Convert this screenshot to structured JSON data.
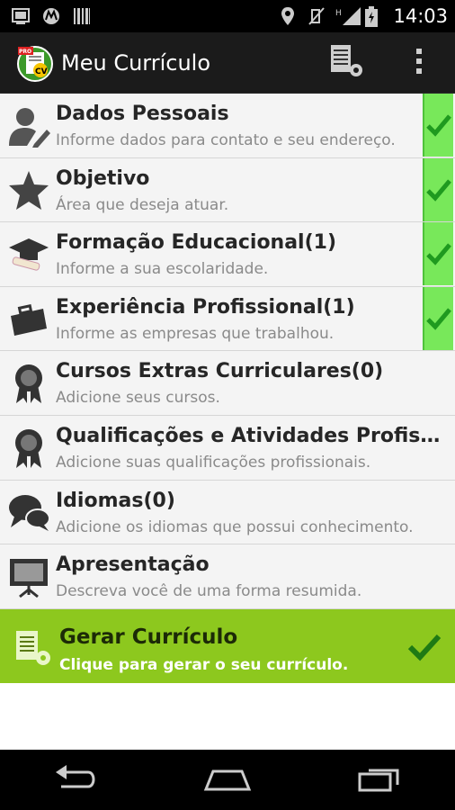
{
  "status_bar": {
    "time": "14:03",
    "icons": [
      "screenshot-icon",
      "motorola-icon",
      "barcode-icon",
      "location-icon",
      "mute-icon",
      "signal-h-icon",
      "battery-icon"
    ]
  },
  "action_bar": {
    "title": "Meu Currículo",
    "app_icon_badge": "PRO",
    "app_icon_letters": "CV",
    "actions": [
      "settings-document-icon",
      "overflow-menu-icon"
    ]
  },
  "sections": [
    {
      "title": "Dados Pessoais",
      "subtitle": "Informe dados para contato e seu endereço.",
      "icon": "user-edit-icon",
      "completed": true
    },
    {
      "title": "Objetivo",
      "subtitle": "Área que deseja atuar.",
      "icon": "star-icon",
      "completed": true
    },
    {
      "title": "Formação Educacional(1)",
      "subtitle": "Informe a sua escolaridade.",
      "icon": "graduation-cap-icon",
      "completed": true
    },
    {
      "title": "Experiência Profissional(1)",
      "subtitle": "Informe as empresas que trabalhou.",
      "icon": "briefcase-icon",
      "completed": true
    },
    {
      "title": "Cursos Extras Curriculares(0)",
      "subtitle": "Adicione seus cursos.",
      "icon": "award-ribbon-icon",
      "completed": false
    },
    {
      "title": "Qualificações e Atividades Profissio…",
      "subtitle": "Adicione suas qualificações profissionais.",
      "icon": "award-ribbon-icon",
      "completed": false
    },
    {
      "title": "Idiomas(0)",
      "subtitle": "Adicione os idiomas que possui conhecimento.",
      "icon": "chat-bubbles-icon",
      "completed": false
    },
    {
      "title": "Apresentação",
      "subtitle": "Descreva você de uma forma resumida.",
      "icon": "presentation-board-icon",
      "completed": false
    }
  ],
  "generate": {
    "title": "Gerar Currículo",
    "subtitle": "Clique para gerar o seu currículo."
  },
  "colors": {
    "check_bg": "#78e85a",
    "check_mark": "#1f9a1f",
    "generate_bg": "#8dc81e",
    "action_bar_bg": "#1b1b1b"
  }
}
